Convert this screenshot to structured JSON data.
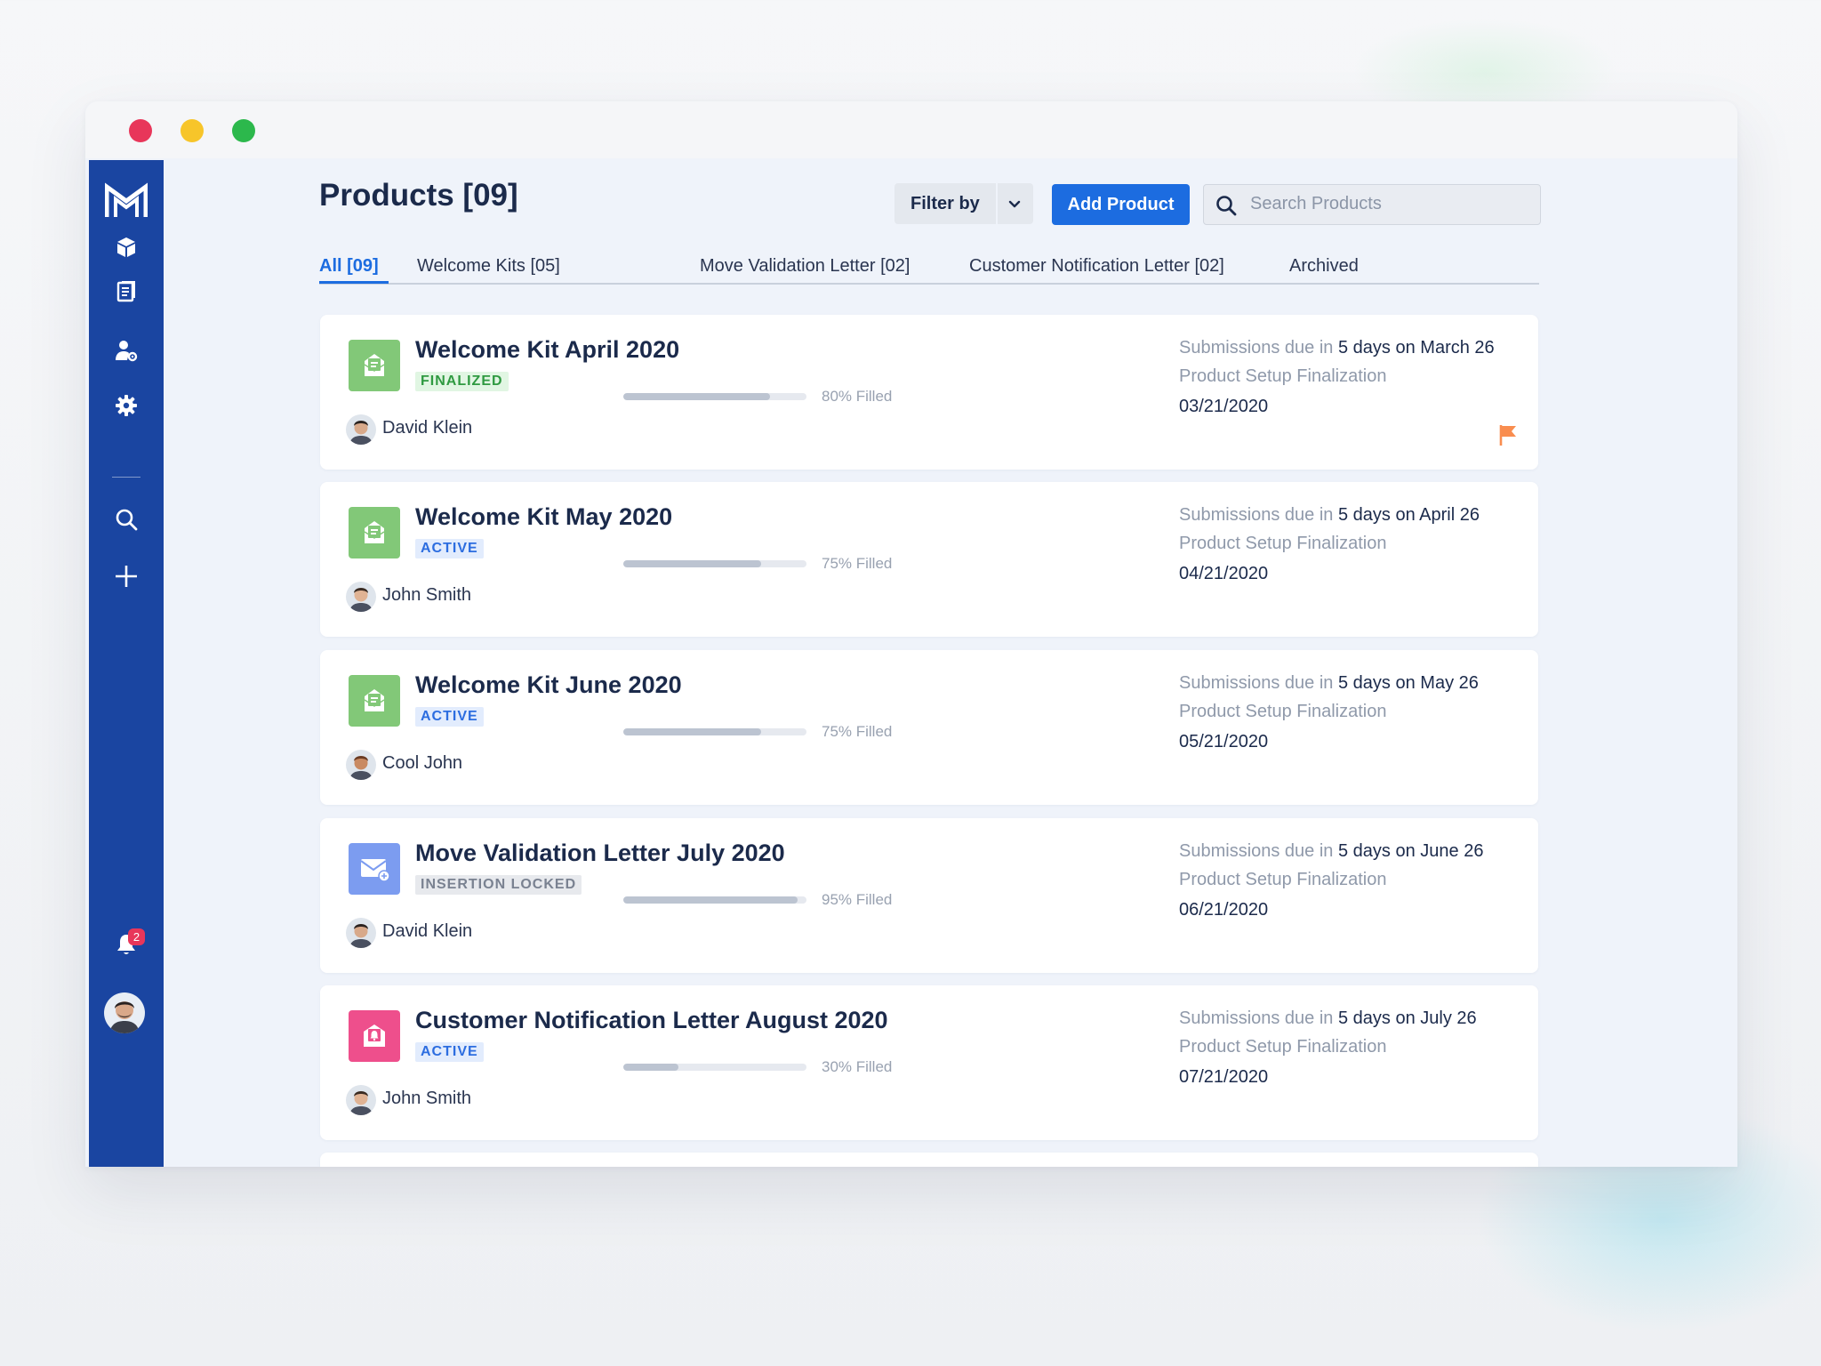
{
  "page": {
    "title": "Products [09]",
    "filter_label": "Filter by",
    "add_label": "Add Product",
    "search_placeholder": "Search Products"
  },
  "tabs": [
    {
      "label": "All [09]",
      "active": true
    },
    {
      "label": "Welcome Kits [05]"
    },
    {
      "label": "Move Validation Letter [02]"
    },
    {
      "label": "Customer Notification Letter [02]"
    },
    {
      "label": "Archived"
    }
  ],
  "notifications": {
    "count": "2"
  },
  "cards": [
    {
      "title": "Welcome Kit April 2020",
      "status": "FINALIZED",
      "progress_percent": 80,
      "progress_label": "80% Filled",
      "owner": "David Klein",
      "due_prefix": "Submissions due in",
      "due_value": "5 days on March 26",
      "stage": "Product Setup Finalization",
      "date": "03/21/2020",
      "icon": "welcome-kit-icon",
      "flagged": true
    },
    {
      "title": "Welcome Kit May 2020",
      "status": "ACTIVE",
      "progress_percent": 75,
      "progress_label": "75% Filled",
      "owner": "John Smith",
      "due_prefix": "Submissions due in",
      "due_value": "5 days on April 26",
      "stage": "Product Setup Finalization",
      "date": "04/21/2020",
      "icon": "welcome-kit-icon"
    },
    {
      "title": "Welcome Kit June 2020",
      "status": "ACTIVE",
      "progress_percent": 75,
      "progress_label": "75% Filled",
      "owner": "Cool John",
      "due_prefix": "Submissions due in",
      "due_value": "5 days on May 26",
      "stage": "Product Setup Finalization",
      "date": "05/21/2020",
      "icon": "welcome-kit-icon"
    },
    {
      "title": "Move Validation Letter July 2020",
      "status": "INSERTION LOCKED",
      "progress_percent": 95,
      "progress_label": "95% Filled",
      "owner": "David Klein",
      "due_prefix": "Submissions due in",
      "due_value": "5 days on June 26",
      "stage": "Product Setup Finalization",
      "date": "06/21/2020",
      "icon": "mail-icon"
    },
    {
      "title": "Customer Notification Letter August 2020",
      "status": "ACTIVE",
      "progress_percent": 30,
      "progress_label": "30% Filled",
      "owner": "John Smith",
      "due_prefix": "Submissions due in",
      "due_value": "5 days on July 26",
      "stage": "Product Setup Finalization",
      "date": "07/21/2020",
      "icon": "notification-letter-icon"
    }
  ],
  "colors": {
    "sidebar": "#1a45a1",
    "accent": "#1c6ce0",
    "welcome_kit_icon": "#82c878",
    "mail_icon": "#7c9cf0",
    "notification_icon": "#ee4f8c",
    "flag": "#f98d4f"
  }
}
